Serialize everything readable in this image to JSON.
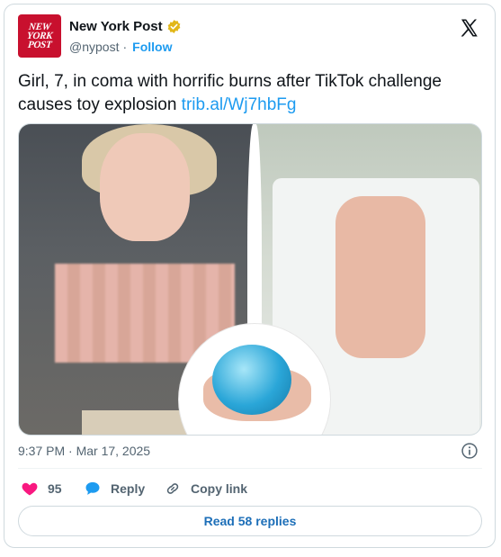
{
  "author": {
    "logo_text": [
      "NEW",
      "YORK",
      "POST"
    ],
    "name": "New York Post",
    "handle": "@nypost",
    "separator": "·",
    "follow_label": "Follow"
  },
  "tweet": {
    "text": "Girl, 7, in coma with horrific burns after TikTok challenge causes toy explosion ",
    "link": "trib.al/Wj7hbFg",
    "timestamp": "9:37 PM · Mar 17, 2025"
  },
  "actions": {
    "like_count": "95",
    "reply_label": "Reply",
    "copy_label": "Copy link"
  },
  "read_replies_label": "Read 58 replies",
  "colors": {
    "accent": "#1d9bf0",
    "like": "#f91880",
    "logo_red": "#c8102e"
  },
  "icons": {
    "verified": "verified-badge-icon",
    "brand": "x-logo-icon",
    "info": "info-icon",
    "like": "heart-icon",
    "reply": "speech-bubble-icon",
    "copy": "link-icon"
  }
}
